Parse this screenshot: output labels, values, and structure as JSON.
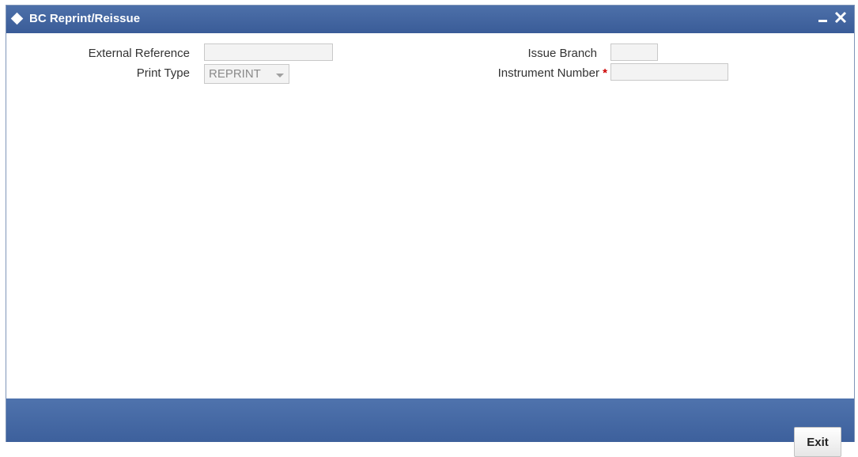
{
  "window": {
    "title": "BC Reprint/Reissue",
    "minimize_symbol": "minimize",
    "close_symbol": "close"
  },
  "form": {
    "external_reference": {
      "label": "External Reference",
      "value": ""
    },
    "print_type": {
      "label": "Print Type",
      "selected": "REPRINT"
    },
    "issue_branch": {
      "label": "Issue Branch",
      "value": ""
    },
    "instrument_number": {
      "label": "Instrument Number",
      "required_marker": "*",
      "value": ""
    }
  },
  "footer": {
    "exit_label": "Exit"
  },
  "colors": {
    "titlebar": "#3f62a0",
    "footer": "#4468a4",
    "required": "#cc0000"
  }
}
